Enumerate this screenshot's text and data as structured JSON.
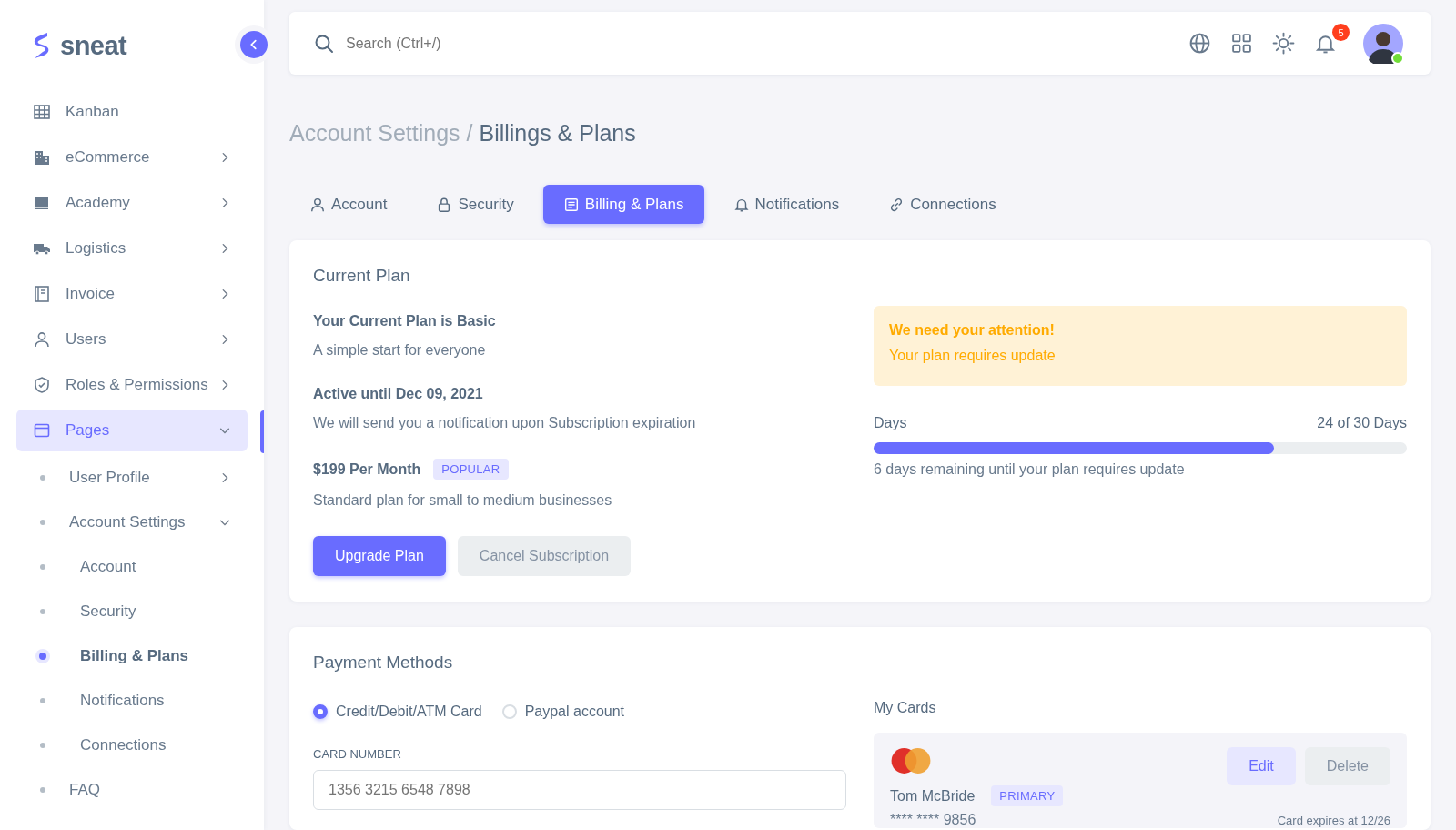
{
  "brand": {
    "name": "sneat"
  },
  "sidebar": {
    "items": [
      {
        "label": "Kanban",
        "kind": "link",
        "selected": false
      },
      {
        "label": "eCommerce",
        "kind": "group",
        "expanded": false,
        "selected": false
      },
      {
        "label": "Academy",
        "kind": "group",
        "expanded": false,
        "selected": false
      },
      {
        "label": "Logistics",
        "kind": "group",
        "expanded": false,
        "selected": false
      },
      {
        "label": "Invoice",
        "kind": "group",
        "expanded": false,
        "selected": false
      },
      {
        "label": "Users",
        "kind": "group",
        "expanded": false,
        "selected": false
      },
      {
        "label": "Roles & Permissions",
        "kind": "group",
        "expanded": false,
        "selected": false
      },
      {
        "label": "Pages",
        "kind": "group",
        "expanded": true,
        "selected": true,
        "children": [
          {
            "label": "User Profile",
            "kind": "group",
            "expanded": false,
            "selected": false
          },
          {
            "label": "Account Settings",
            "kind": "group",
            "expanded": true,
            "selected": false,
            "children": [
              {
                "label": "Account",
                "kind": "link",
                "selected": false
              },
              {
                "label": "Security",
                "kind": "link",
                "selected": false
              },
              {
                "label": "Billing & Plans",
                "kind": "link",
                "selected": true
              },
              {
                "label": "Notifications",
                "kind": "link",
                "selected": false
              },
              {
                "label": "Connections",
                "kind": "link",
                "selected": false
              }
            ]
          },
          {
            "label": "FAQ",
            "kind": "link",
            "selected": false
          }
        ]
      }
    ]
  },
  "topbar": {
    "search": {
      "placeholder": "Search (Ctrl+/)"
    },
    "notification_count": "5",
    "avatar_online": true
  },
  "breadcrumb": {
    "parent": "Account Settings /",
    "current": "Billings & Plans"
  },
  "tabs": [
    {
      "label": "Account",
      "selected": false
    },
    {
      "label": "Security",
      "selected": false
    },
    {
      "label": "Billing & Plans",
      "selected": true
    },
    {
      "label": "Notifications",
      "selected": false
    },
    {
      "label": "Connections",
      "selected": false
    }
  ],
  "current_plan": {
    "title": "Current Plan",
    "plan_heading": "Your Current Plan is Basic",
    "plan_text": "A simple start for everyone",
    "active_heading": "Active until Dec 09, 2021",
    "active_text": "We will send you a notification upon Subscription expiration",
    "price_heading": "$199 Per Month",
    "price_badge": "POPULAR",
    "price_text": "Standard plan for small to medium businesses",
    "buttons": [
      "Upgrade Plan",
      "Cancel Subscription"
    ],
    "alert": {
      "title": "We need your attention!",
      "text": "Your plan requires update"
    },
    "days": {
      "label": "Days",
      "reading": "24 of 30 Days",
      "level": 0.75,
      "note": "6 days remaining until your plan requires update"
    }
  },
  "payment_methods": {
    "title": "Payment Methods",
    "options": [
      {
        "label": "Credit/Debit/ATM Card",
        "selected": true
      },
      {
        "label": "Paypal account",
        "selected": false
      }
    ],
    "card_number": {
      "label": "CARD NUMBER",
      "placeholder": "1356 3215 6548 7898"
    },
    "my_cards": {
      "title": "My Cards",
      "cards": [
        {
          "name": "Tom McBride",
          "badge": "PRIMARY",
          "number": "**** **** 9856",
          "expiry": "Card expires at 12/26",
          "buttons": [
            "Edit",
            "Delete"
          ]
        }
      ]
    }
  }
}
